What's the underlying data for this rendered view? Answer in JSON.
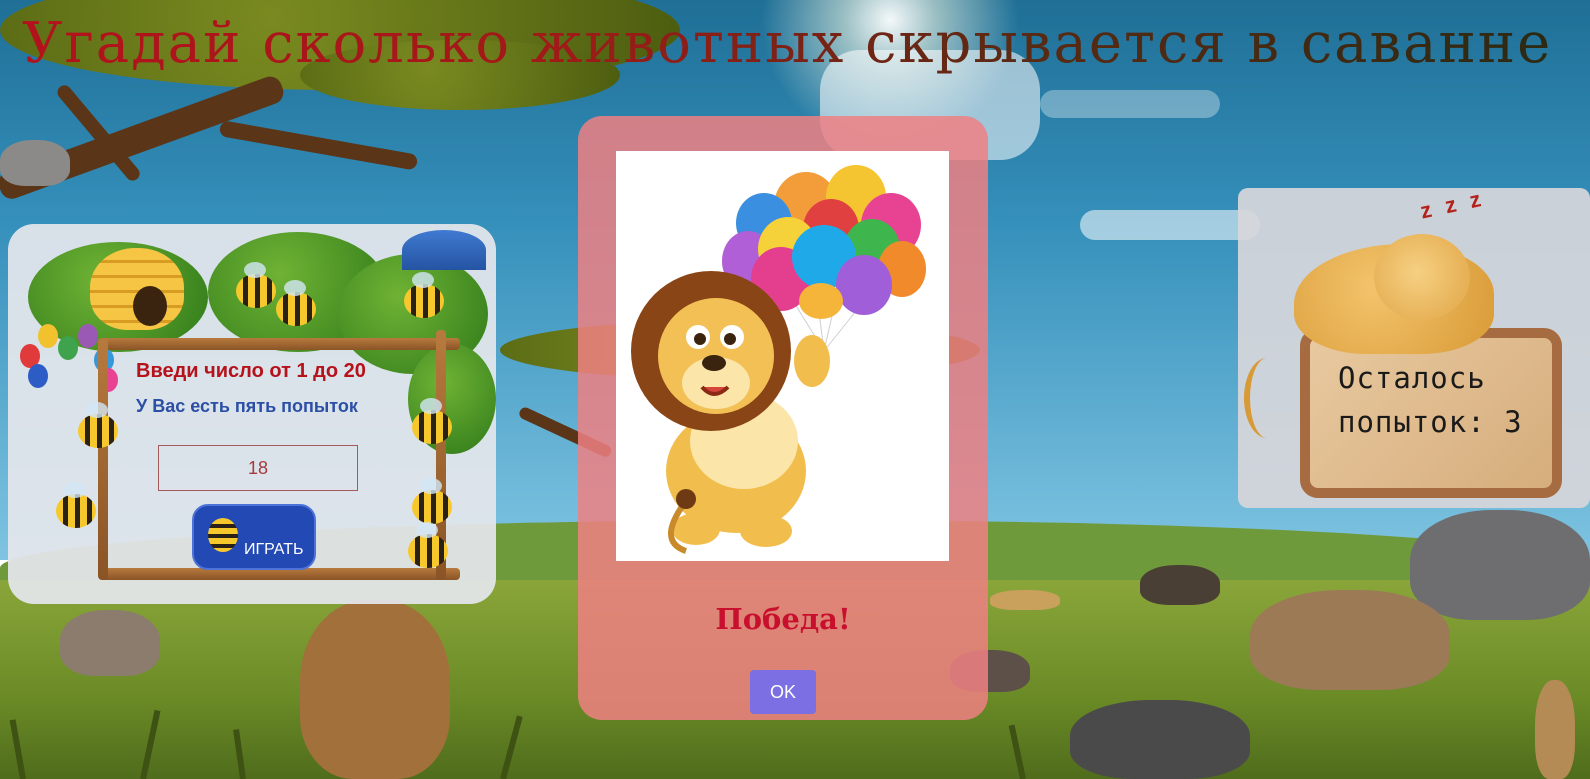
{
  "page": {
    "title": "Угадай сколько животных скрывается в саванне"
  },
  "game_panel": {
    "prompt": "Введи число от 1 до 20",
    "attempts_info": "У Вас есть пять попыток",
    "guess_value": "18",
    "play_button": "ИГРАТЬ"
  },
  "status_panel": {
    "attempts_left_line1": "Осталось",
    "attempts_left_line2": "попыток: 3",
    "sleep_mark": "z z z"
  },
  "modal": {
    "result": "Победа!",
    "ok_button": "OK"
  },
  "colors": {
    "title_red": "#b3121c",
    "prompt_red": "#b5121b",
    "info_blue": "#2c4fa6",
    "play_button": "#2349b5",
    "modal_bg": "#ee8082",
    "victory_red": "#c8102e",
    "ok_button": "#7b6fe3"
  },
  "icons": {
    "play_button_icon": "bee-icon",
    "modal_image": "lion-with-balloons",
    "status_image": "sleeping-lion"
  }
}
